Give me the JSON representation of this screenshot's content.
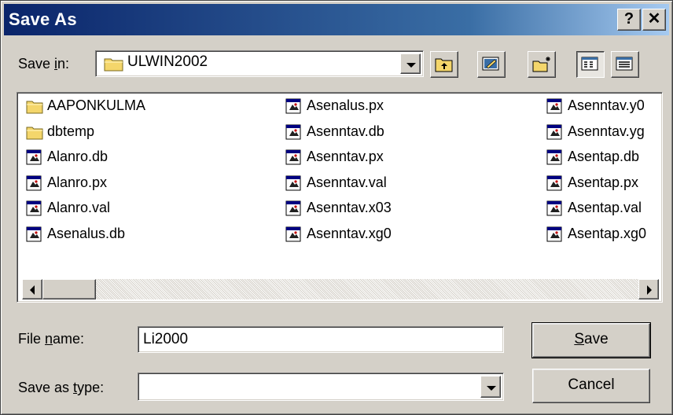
{
  "window": {
    "title": "Save As"
  },
  "titlebar": {
    "help_label": "?",
    "close_label": "✕"
  },
  "save_in": {
    "label_prefix": "Save ",
    "label_accel": "i",
    "label_suffix": "n:",
    "value": "ULWIN2002"
  },
  "toolbar": {
    "icons": [
      "up-one-level-icon",
      "desktop-icon",
      "new-folder-icon",
      "list-view-icon",
      "details-view-icon"
    ]
  },
  "files": {
    "column1": [
      {
        "name": "AAPONKULMA",
        "type": "folder"
      },
      {
        "name": "dbtemp",
        "type": "folder"
      },
      {
        "name": "Alanro.db",
        "type": "file"
      },
      {
        "name": "Alanro.px",
        "type": "file"
      },
      {
        "name": "Alanro.val",
        "type": "file"
      },
      {
        "name": "Asenalus.db",
        "type": "file"
      }
    ],
    "column2": [
      {
        "name": "Asenalus.px",
        "type": "file"
      },
      {
        "name": "Asenntav.db",
        "type": "file"
      },
      {
        "name": "Asenntav.px",
        "type": "file"
      },
      {
        "name": "Asenntav.val",
        "type": "file"
      },
      {
        "name": "Asenntav.x03",
        "type": "file"
      },
      {
        "name": "Asenntav.xg0",
        "type": "file"
      }
    ],
    "column3": [
      {
        "name": "Asenntav.y0",
        "type": "file"
      },
      {
        "name": "Asenntav.yg",
        "type": "file"
      },
      {
        "name": "Asentap.db",
        "type": "file"
      },
      {
        "name": "Asentap.px",
        "type": "file"
      },
      {
        "name": "Asentap.val",
        "type": "file"
      },
      {
        "name": "Asentap.xg0",
        "type": "file"
      }
    ]
  },
  "file_name": {
    "label_prefix": "File ",
    "label_accel": "n",
    "label_suffix": "ame:",
    "value": "Li2000"
  },
  "save_as_type": {
    "label_prefix": "Save as ",
    "label_accel": "t",
    "label_suffix": "ype:",
    "value": ""
  },
  "buttons": {
    "save_accel": "S",
    "save_rest": "ave",
    "cancel": "Cancel"
  },
  "colors": {
    "titlebar_start": "#0a246a",
    "titlebar_end": "#a6caf0",
    "face": "#d4d0c8",
    "folder": "#f4d66b"
  }
}
